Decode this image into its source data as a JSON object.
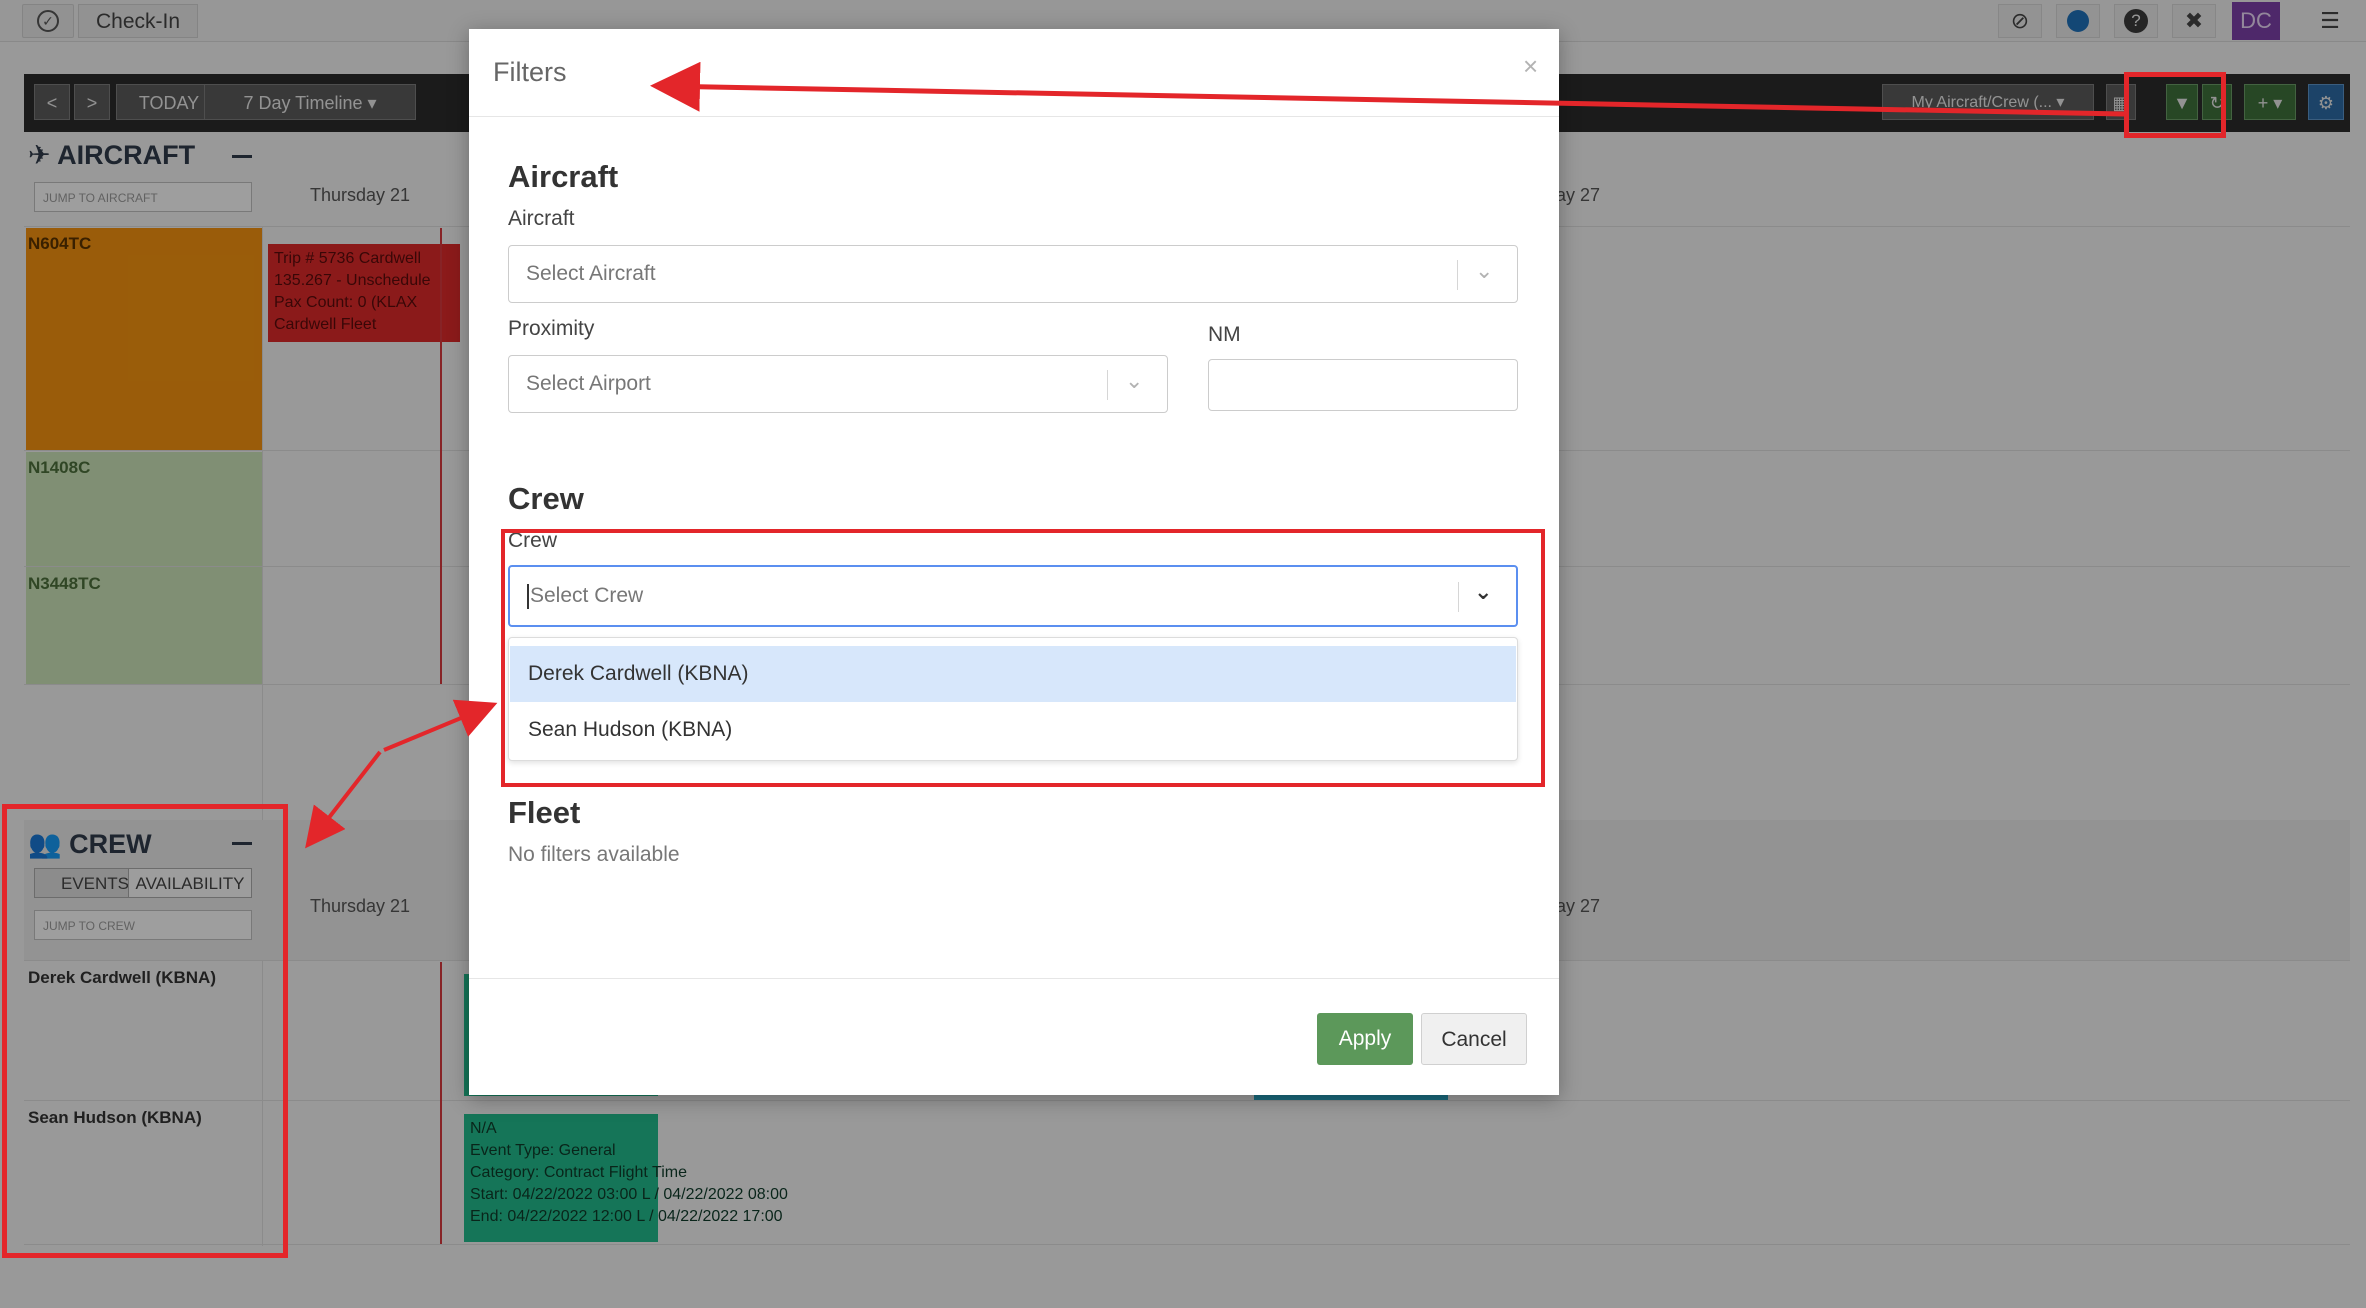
{
  "topnav": {
    "checkin_label": "Check-In",
    "avatar_initials": "DC",
    "icons": [
      "compass-icon",
      "chat-icon",
      "help-icon",
      "expand-icon",
      "hamburger-icon"
    ]
  },
  "toolbar": {
    "prev": "<",
    "next": ">",
    "today": "TODAY",
    "timeline": "7 Day Timeline ▾",
    "view_select": "My Aircraft/Crew (... ▾"
  },
  "aircraft_section": {
    "title": "AIRCRAFT",
    "jump_placeholder": "JUMP TO AIRCRAFT",
    "day_left": "Thursday 21",
    "day_right": "day 27",
    "rows": [
      "N604TC",
      "N1408C",
      "N3448TC"
    ],
    "trip_event": [
      "Trip # 5736 Cardwell",
      "135.267 - Unschedule",
      "Pax Count: 0 (KLAX",
      "Cardwell Fleet"
    ]
  },
  "crew_section": {
    "title": "CREW",
    "tab_events": "EVENTS",
    "tab_availability": "AVAILABILITY",
    "jump_placeholder": "JUMP TO CREW",
    "day_left": "Thursday 21",
    "day_right": "day 27",
    "rows": [
      "Derek Cardwell (KBNA)",
      "Sean Hudson (KBNA)"
    ],
    "event": [
      "N/A",
      "Event Type: General",
      "Category: Contract Flight Time",
      "Start: 04/22/2022 03:00 L / 04/22/2022 08:00",
      "End: 04/22/2022 12:00 L / 04/22/2022 17:00"
    ]
  },
  "modal": {
    "title": "Filters",
    "close": "×",
    "aircraft_heading": "Aircraft",
    "aircraft_label": "Aircraft",
    "aircraft_placeholder": "Select Aircraft",
    "proximity_label": "Proximity",
    "proximity_placeholder": "Select Airport",
    "nm_label": "NM",
    "nm_value": "",
    "crew_heading": "Crew",
    "crew_label": "Crew",
    "crew_placeholder": "Select Crew",
    "crew_options": [
      "Derek Cardwell (KBNA)",
      "Sean Hudson (KBNA)"
    ],
    "fleet_heading": "Fleet",
    "fleet_empty": "No filters available",
    "apply": "Apply",
    "cancel": "Cancel"
  },
  "colors": {
    "annotation_red": "#e3262a",
    "apply_green": "#5c985a",
    "option_highlight": "#d7e7fb",
    "focus_blue": "#5b8ff0"
  }
}
